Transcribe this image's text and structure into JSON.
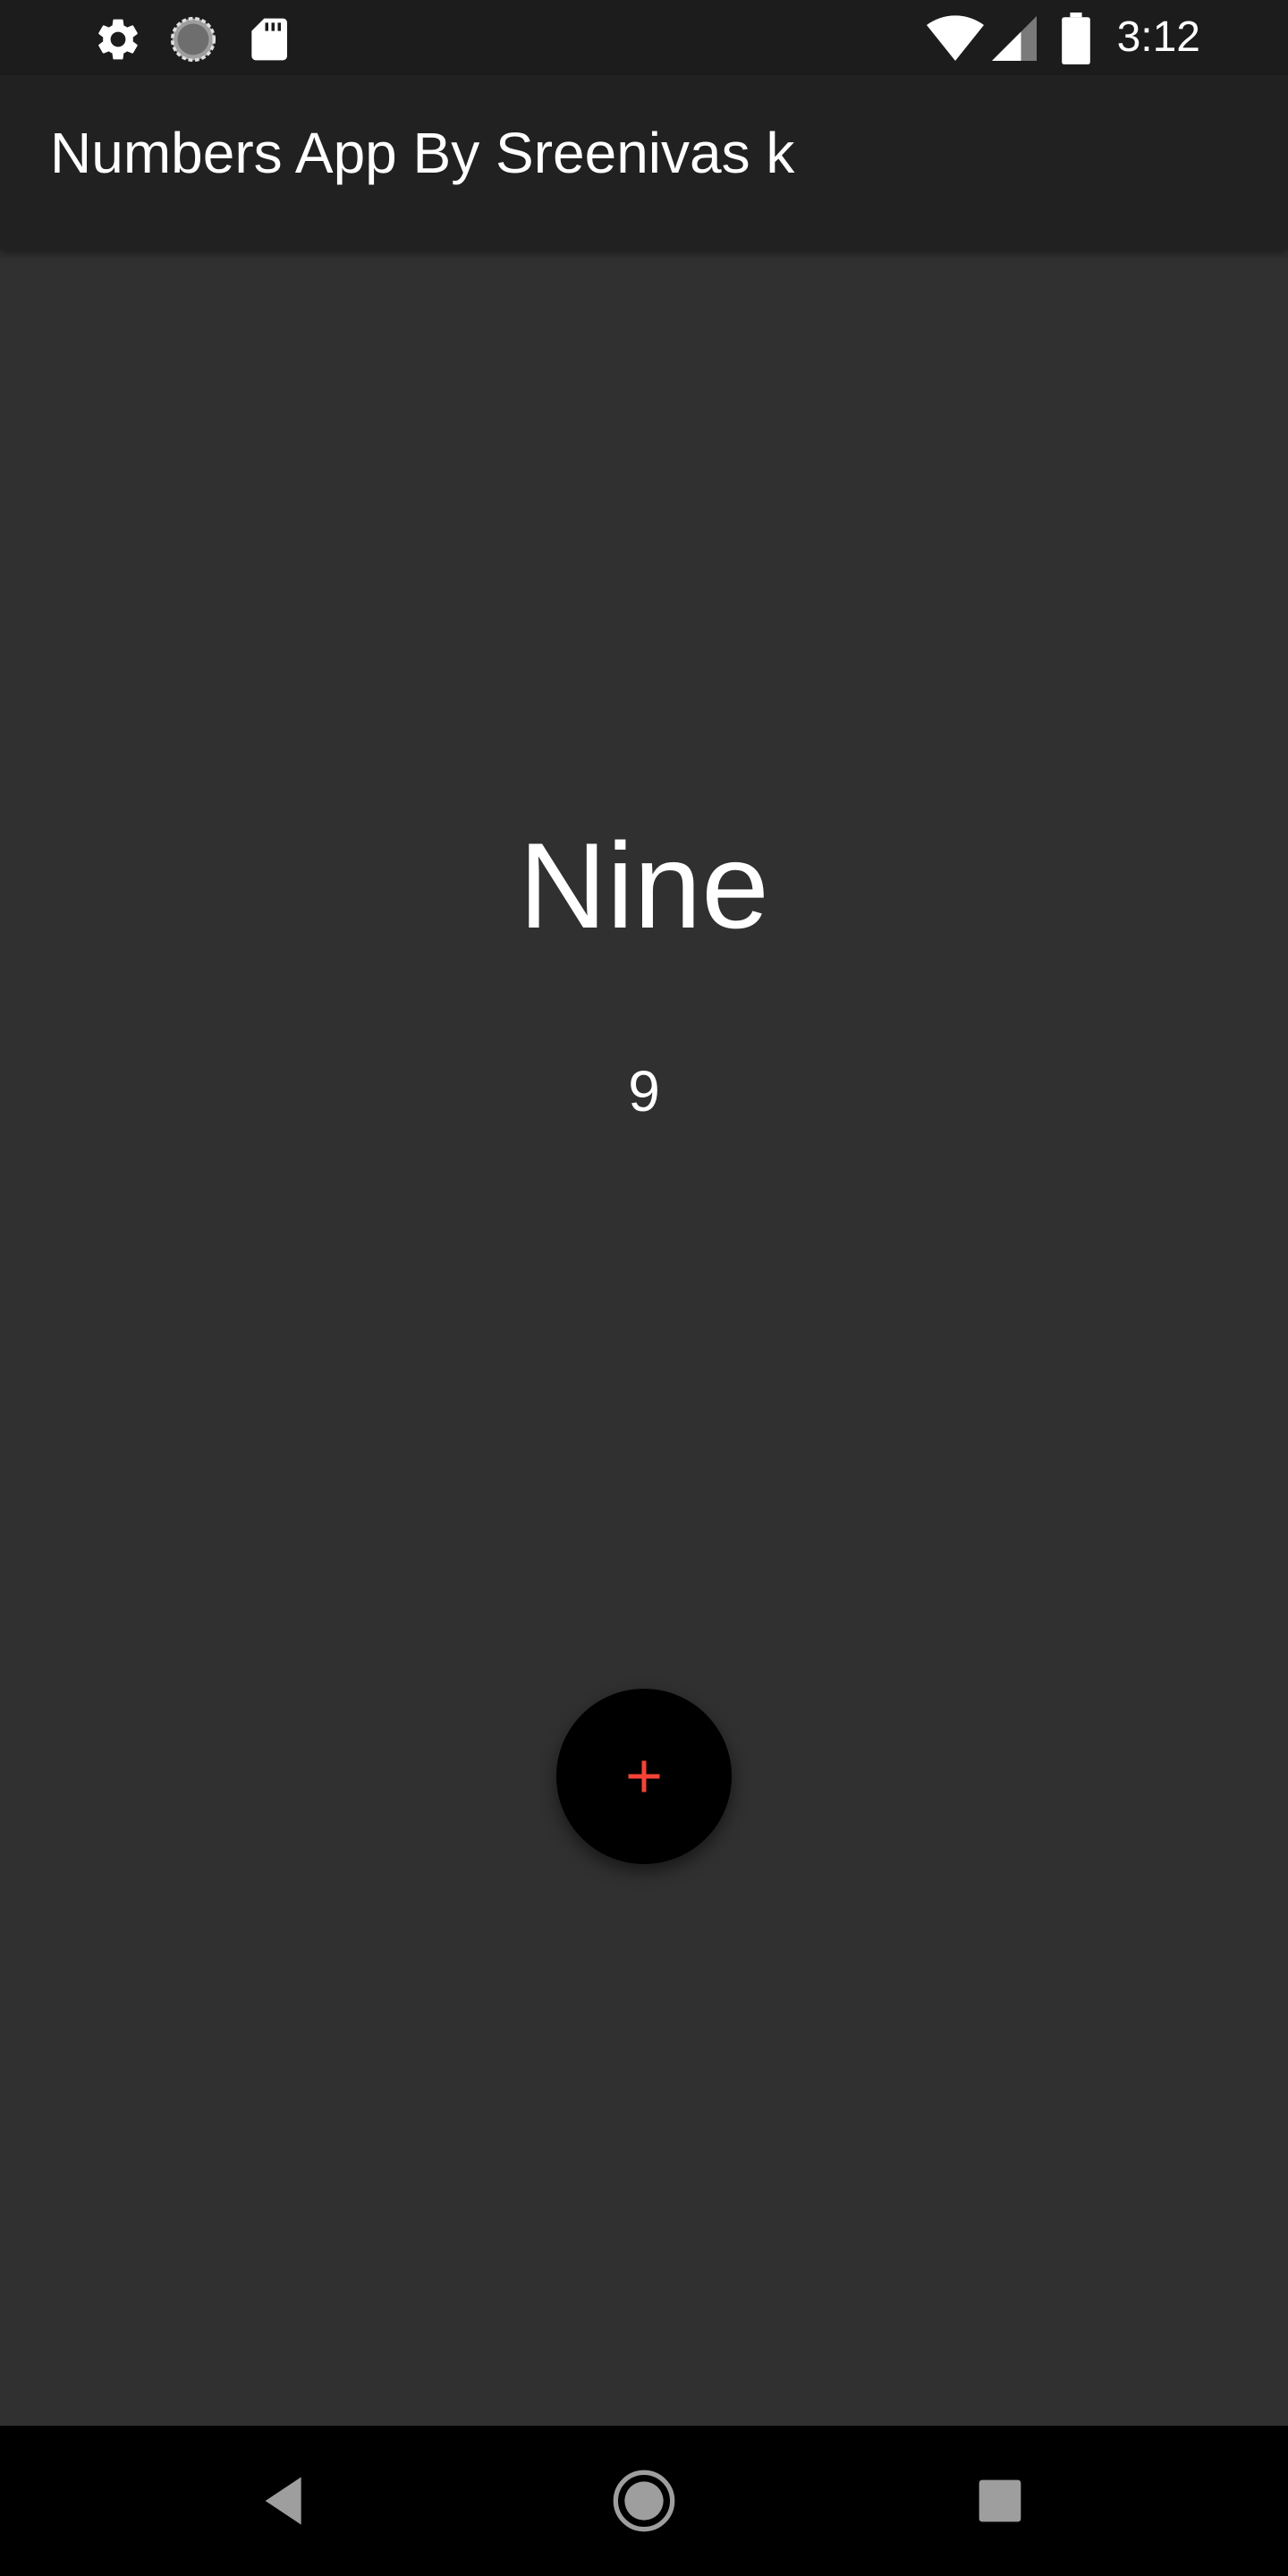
{
  "status_bar": {
    "time": "3:12",
    "left_icons": [
      "settings-icon",
      "sync-icon",
      "sd-card-icon"
    ],
    "right_icons": [
      "wifi-icon",
      "cell-signal-icon",
      "battery-icon"
    ]
  },
  "app_bar": {
    "title": "Numbers App By Sreenivas k"
  },
  "main": {
    "number_word": "Nine",
    "number_digit": "9"
  },
  "fab": {
    "icon": "plus-icon",
    "color": "#f44336"
  },
  "nav_bar": {
    "buttons": [
      "back-icon",
      "home-icon",
      "recents-icon"
    ]
  },
  "colors": {
    "background": "#303030",
    "app_bar": "#212121",
    "status_bar": "#1c1c1c",
    "fab_background": "#000000",
    "accent": "#f44336"
  }
}
